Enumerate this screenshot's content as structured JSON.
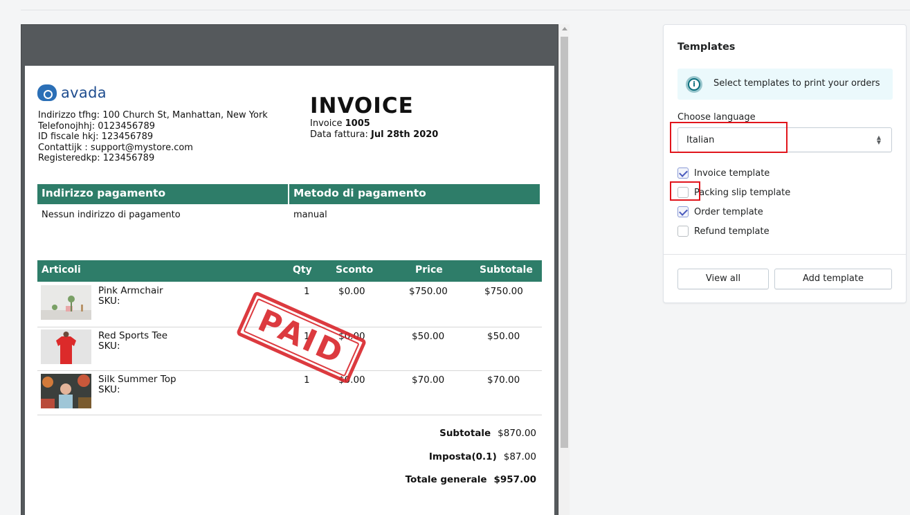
{
  "invoice": {
    "logo_text": "avada",
    "store_lines": [
      "Indirizzo tfhg: 100 Church St, Manhattan, New York",
      "Telefonojhhj: 0123456789",
      "ID fiscale hkj: 123456789",
      "Contattijk : support@mystore.com",
      "Registeredkp: 123456789"
    ],
    "title": "INVOICE",
    "number_label": "Invoice",
    "number": "1005",
    "date_label": "Data fattura:",
    "date": "Jul 28th 2020",
    "billing_head": "Indirizzo pagamento",
    "billing_value": "Nessun indirizzo di pagamento",
    "payment_head": "Metodo di pagamento",
    "payment_value": "manual",
    "columns": [
      "Articoli",
      "Qty",
      "Sconto",
      "Price",
      "Subtotale"
    ],
    "items": [
      {
        "name": "Pink Armchair",
        "sku": "SKU:",
        "qty": "1",
        "discount": "$0.00",
        "price": "$750.00",
        "subtotal": "$750.00",
        "thumb": "armchair-photo"
      },
      {
        "name": "Red Sports Tee",
        "sku": "SKU:",
        "qty": "1",
        "discount": "$0.00",
        "price": "$50.00",
        "subtotal": "$50.00",
        "thumb": "red-tee-photo"
      },
      {
        "name": "Silk Summer Top",
        "sku": "SKU:",
        "qty": "1",
        "discount": "$0.00",
        "price": "$70.00",
        "subtotal": "$70.00",
        "thumb": "summer-top-photo"
      }
    ],
    "stamp": "PAID",
    "subtotal_label": "Subtotale",
    "subtotal": "$870.00",
    "tax_label": "Imposta(0.1)",
    "tax": "$87.00",
    "total_label": "Totale generale",
    "total": "$957.00"
  },
  "panel": {
    "title": "Templates",
    "banner": "Select templates to print your orders",
    "language_label": "Choose language",
    "language_value": "Italian",
    "templates": [
      {
        "label": "Invoice template",
        "checked": true
      },
      {
        "label": "Packing slip template",
        "checked": false
      },
      {
        "label": "Order template",
        "checked": true
      },
      {
        "label": "Refund template",
        "checked": false
      }
    ],
    "view_all": "View all",
    "add_template": "Add template"
  },
  "colors": {
    "invoice_accent": "#2e7d69",
    "stamp": "#d9252b",
    "highlight": "#e1141b"
  }
}
